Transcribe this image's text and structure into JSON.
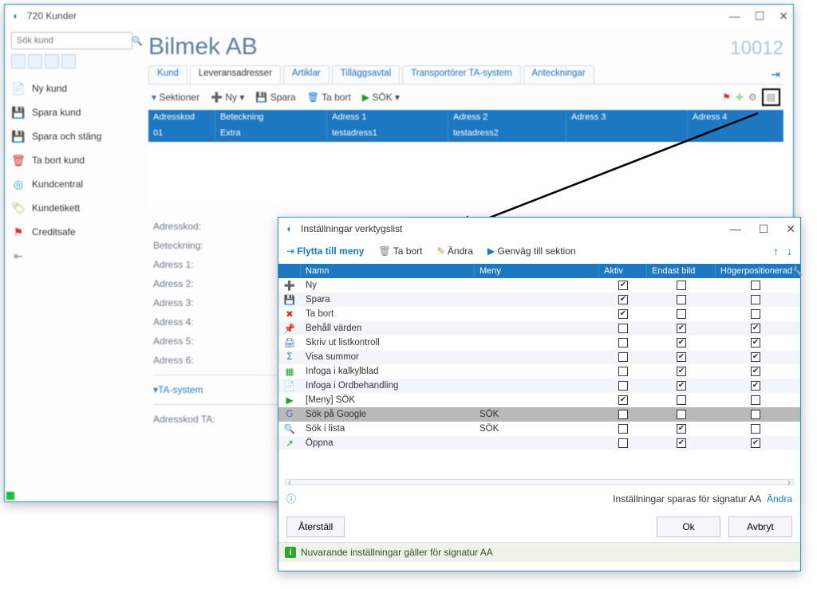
{
  "main_window": {
    "title": "720 Kunder",
    "customer_name": "Bilmek AB",
    "customer_id": "10012",
    "tabs": [
      "Kund",
      "Leveransadresser",
      "Artiklar",
      "Tilläggsavtal",
      "Transportörer TA-system",
      "Anteckningar"
    ],
    "search_placeholder": "Sök kund",
    "sidebar": [
      "Ny kund",
      "Spara kund",
      "Spara och stäng",
      "Ta bort kund",
      "Kundcentral",
      "Kundetikett",
      "Creditsafe"
    ],
    "toolbar": {
      "sektioner": "Sektioner",
      "ny": "Ny",
      "spara": "Spara",
      "tabort": "Ta bort",
      "sok": "SÖK"
    },
    "grid_head": [
      "Adresskod",
      "Beteckning",
      "Adress 1",
      "Adress 2",
      "Adress 3",
      "Adress 4"
    ],
    "grid_row": [
      "01",
      "Extra",
      "testadress1",
      "testadress2",
      "",
      ""
    ],
    "details_labels": [
      "Adresskod:",
      "Beteckning:",
      "Adress 1:",
      "Adress 2:",
      "Adress 3:",
      "Adress 4:",
      "Adress 5:",
      "Adress 6:"
    ],
    "ta_link": "TA-system",
    "adresskod_ta": "Adresskod TA:"
  },
  "dialog": {
    "title": "Inställningar verktygslist",
    "tools": {
      "flytta": "Flytta till meny",
      "tabort": "Ta bort",
      "andra": "Ändra",
      "genvag": "Genväg till sektion"
    },
    "columns": [
      "",
      "Namn",
      "Meny",
      "Aktiv",
      "Endast bild",
      "Högerpositionerad"
    ],
    "rows": [
      {
        "icon": "➕",
        "color": "#1aa01a",
        "name": "Ny",
        "menu": "",
        "aktiv": true,
        "endast": false,
        "hoger": false
      },
      {
        "icon": "💾",
        "color": "#4a5fa0",
        "name": "Spara",
        "menu": "",
        "aktiv": true,
        "endast": false,
        "hoger": false
      },
      {
        "icon": "✖",
        "color": "#c0392b",
        "name": "Ta bort",
        "menu": "",
        "aktiv": true,
        "endast": false,
        "hoger": false
      },
      {
        "icon": "📌",
        "color": "#c0392b",
        "name": "Behåll värden",
        "menu": "",
        "aktiv": false,
        "endast": true,
        "hoger": true
      },
      {
        "icon": "🖨",
        "color": "#3a6fb8",
        "name": "Skriv ut listkontroll",
        "menu": "",
        "aktiv": false,
        "endast": true,
        "hoger": true
      },
      {
        "icon": "Σ",
        "color": "#3a6fb8",
        "name": "Visa summor",
        "menu": "",
        "aktiv": false,
        "endast": true,
        "hoger": true
      },
      {
        "icon": "▦",
        "color": "#1aa01a",
        "name": "Infoga i kalkylblad",
        "menu": "",
        "aktiv": false,
        "endast": true,
        "hoger": true
      },
      {
        "icon": "📄",
        "color": "#3a6fb8",
        "name": "Infoga i Ordbehandling",
        "menu": "",
        "aktiv": false,
        "endast": true,
        "hoger": true
      },
      {
        "icon": "▶",
        "color": "#1aa01a",
        "name": "[Meny] SÖK",
        "menu": "",
        "aktiv": true,
        "endast": false,
        "hoger": false
      },
      {
        "icon": "G",
        "color": "#3a6fb8",
        "name": "Sök på Google",
        "menu": "SÖK",
        "aktiv": false,
        "endast": false,
        "hoger": false,
        "selected": true
      },
      {
        "icon": "🔍",
        "color": "#3a6fb8",
        "name": "Sök i lista",
        "menu": "SÖK",
        "aktiv": false,
        "endast": true,
        "hoger": false
      },
      {
        "icon": "↗",
        "color": "#1aa01a",
        "name": "Öppna",
        "menu": "",
        "aktiv": false,
        "endast": true,
        "hoger": true
      }
    ],
    "info_text": "Inställningar sparas för signatur AA",
    "info_link": "Ändra",
    "btn_reset": "Återställ",
    "btn_ok": "Ok",
    "btn_cancel": "Avbryt",
    "status": "Nuvarande inställningar gäller för signatur AA"
  }
}
